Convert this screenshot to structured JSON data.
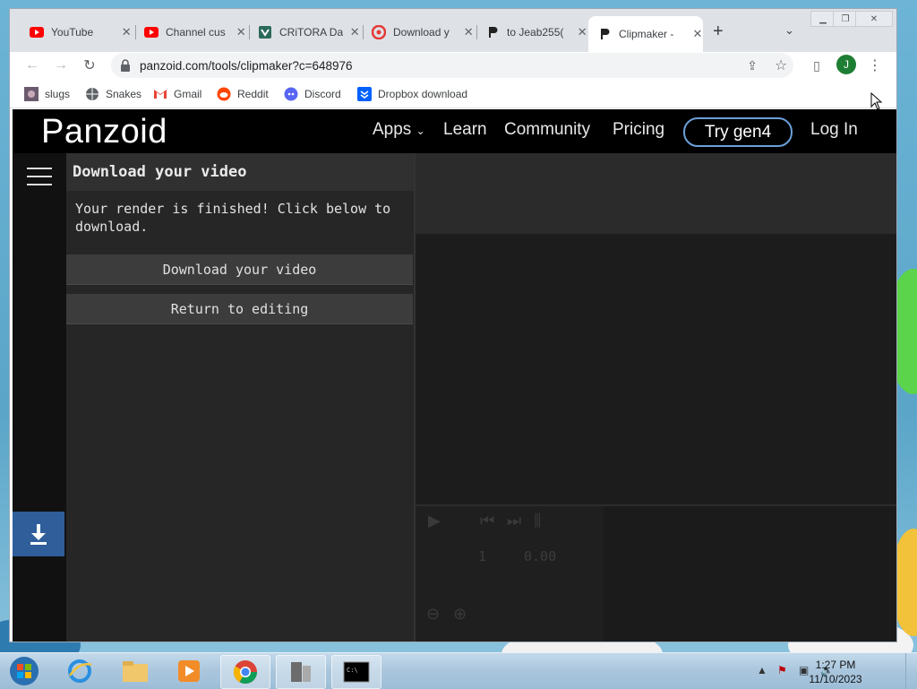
{
  "browser": {
    "tabs": [
      {
        "title": "YouTube",
        "icon": "youtube-icon"
      },
      {
        "title": "Channel cus",
        "icon": "youtube-icon"
      },
      {
        "title": "CRiTORA Da",
        "icon": "critora-icon"
      },
      {
        "title": "Download y",
        "icon": "download-icon"
      },
      {
        "title": "to Jeab255(",
        "icon": "panzoid-icon"
      },
      {
        "title": "Clipmaker -",
        "icon": "panzoid-icon",
        "active": true
      }
    ],
    "url": "panzoid.com/tools/clipmaker?c=648976",
    "profile_initial": "J",
    "bookmarks": [
      {
        "label": "slugs",
        "icon": "slug-icon"
      },
      {
        "label": "Snakes",
        "icon": "globe-icon"
      },
      {
        "label": "Gmail",
        "icon": "gmail-icon"
      },
      {
        "label": "Reddit",
        "icon": "reddit-icon"
      },
      {
        "label": "Discord",
        "icon": "discord-icon"
      },
      {
        "label": "Dropbox download",
        "icon": "dropbox-icon"
      }
    ]
  },
  "site": {
    "logo": "Panzoid",
    "nav": {
      "apps": "Apps",
      "learn": "Learn",
      "community": "Community",
      "pricing": "Pricing",
      "try": "Try gen4",
      "login": "Log In"
    }
  },
  "panel": {
    "title": "Download your video",
    "message": "Your render is finished! Click below to download.",
    "download_button": "Download your video",
    "return_button": "Return to editing"
  },
  "timeline": {
    "frame": "1",
    "time": "0.00"
  },
  "taskbar": {
    "time": "1:27 PM",
    "date": "11/10/2023"
  },
  "colors": {
    "accent_blue": "#2f5e9b",
    "try_border": "#6aa0d8",
    "header_bg": "#000000",
    "panel_bg": "#262626"
  }
}
